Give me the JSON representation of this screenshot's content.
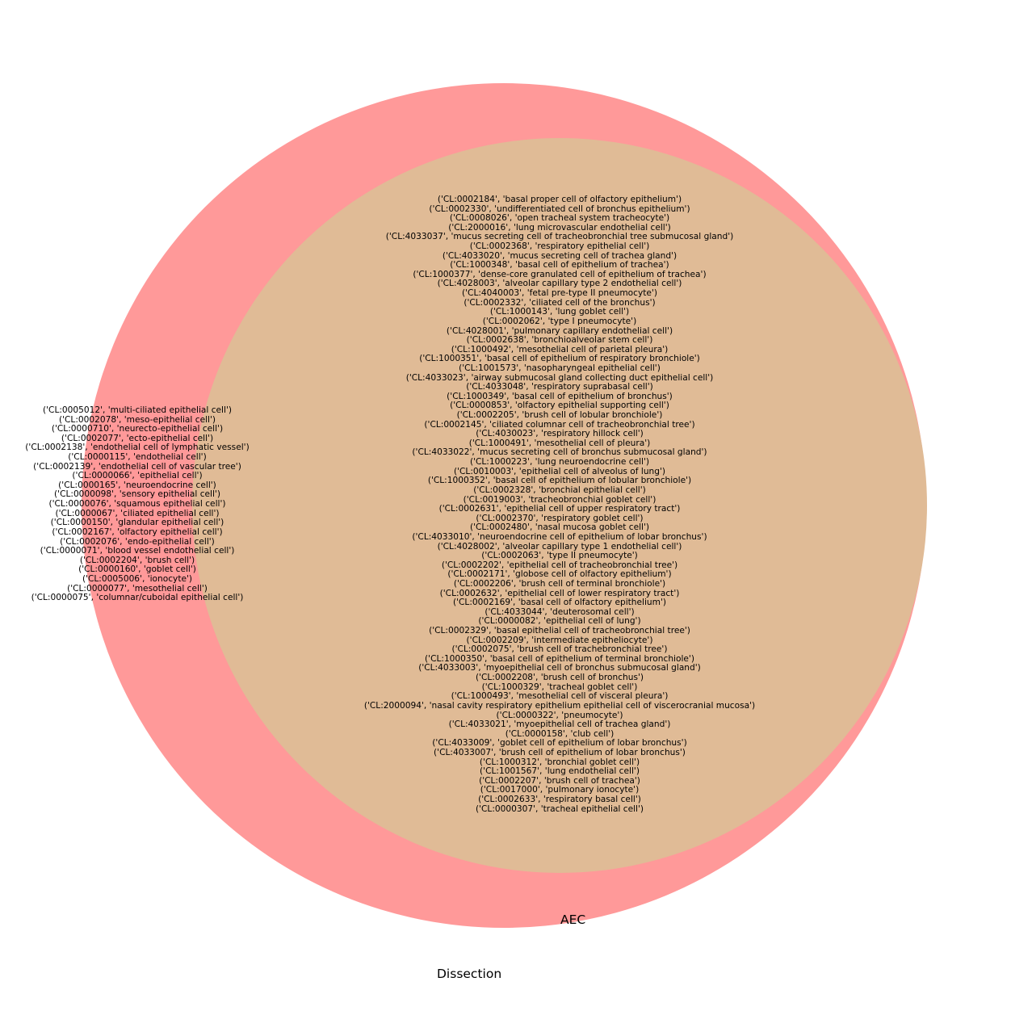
{
  "chart_data": {
    "type": "venn2",
    "title": "",
    "sets": [
      {
        "name": "Dissection",
        "size": 88,
        "color": "#ff9999"
      },
      {
        "name": "AEC",
        "size": 66,
        "color": "#e0bb96"
      }
    ],
    "relation": "AEC is a subset of Dissection",
    "regions": {
      "dissection_only": {
        "count": 21,
        "items": [
          "('CL:0005012', 'multi-ciliated epithelial cell')",
          "('CL:0002078', 'meso-epithelial cell')",
          "('CL:0000710', 'neurecto-epithelial cell')",
          "('CL:0002077', 'ecto-epithelial cell')",
          "('CL:0002138', 'endothelial cell of lymphatic vessel')",
          "('CL:0000115', 'endothelial cell')",
          "('CL:0002139', 'endothelial cell of vascular tree')",
          "('CL:0000066', 'epithelial cell')",
          "('CL:0000165', 'neuroendocrine cell')",
          "('CL:0000098', 'sensory epithelial cell')",
          "('CL:0000076', 'squamous epithelial cell')",
          "('CL:0000067', 'ciliated epithelial cell')",
          "('CL:0000150', 'glandular epithelial cell')",
          "('CL:0002167', 'olfactory epithelial cell')",
          "('CL:0002076', 'endo-epithelial cell')",
          "('CL:0000071', 'blood vessel endothelial cell')",
          "('CL:0002204', 'brush cell')",
          "('CL:0000160', 'goblet cell')",
          "('CL:0005006', 'ionocyte')",
          "('CL:0000077', 'mesothelial cell')",
          "('CL:0000075', 'columnar/cuboidal epithelial cell')"
        ]
      },
      "intersection": {
        "count": 66,
        "items": [
          "('CL:0002184', 'basal proper cell of olfactory epithelium')",
          "('CL:0002330', 'undifferentiated cell of bronchus epithelium')",
          "('CL:0008026', 'open tracheal system tracheocyte')",
          "('CL:2000016', 'lung microvascular endothelial cell')",
          "('CL:4033037', 'mucus secreting cell of tracheobronchial tree submucosal gland')",
          "('CL:0002368', 'respiratory epithelial cell')",
          "('CL:4033020', 'mucus secreting cell of trachea gland')",
          "('CL:1000348', 'basal cell of epithelium of trachea')",
          "('CL:1000377', 'dense-core granulated cell of epithelium of trachea')",
          "('CL:4028003', 'alveolar capillary type 2 endothelial cell')",
          "('CL:4040003', 'fetal pre-type II pneumocyte')",
          "('CL:0002332', 'ciliated cell of the bronchus')",
          "('CL:1000143', 'lung goblet cell')",
          "('CL:0002062', 'type I pneumocyte')",
          "('CL:4028001', 'pulmonary capillary endothelial cell')",
          "('CL:0002638', 'bronchioalveolar stem cell')",
          "('CL:1000492', 'mesothelial cell of parietal pleura')",
          "('CL:1000351', 'basal cell of epithelium of respiratory bronchiole')",
          "('CL:1001573', 'nasopharyngeal epithelial cell')",
          "('CL:4033023', 'airway submucosal gland collecting duct epithelial cell')",
          "('CL:4033048', 'respiratory suprabasal cell')",
          "('CL:1000349', 'basal cell of epithelium of bronchus')",
          "('CL:0000853', 'olfactory epithelial supporting cell')",
          "('CL:0002205', 'brush cell of lobular bronchiole')",
          "('CL:0002145', 'ciliated columnar cell of tracheobronchial tree')",
          "('CL:4030023', 'respiratory hillock cell')",
          "('CL:1000491', 'mesothelial cell of pleura')",
          "('CL:4033022', 'mucus secreting cell of bronchus submucosal gland')",
          "('CL:1000223', 'lung neuroendocrine cell')",
          "('CL:0010003', 'epithelial cell of alveolus of lung')",
          "('CL:1000352', 'basal cell of epithelium of lobular bronchiole')",
          "('CL:0002328', 'bronchial epithelial cell')",
          "('CL:0019003', 'tracheobronchial goblet cell')",
          "('CL:0002631', 'epithelial cell of upper respiratory tract')",
          "('CL:0002370', 'respiratory goblet cell')",
          "('CL:0002480', 'nasal mucosa goblet cell')",
          "('CL:4033010', 'neuroendocrine cell of epithelium of lobar bronchus')",
          "('CL:4028002', 'alveolar capillary type 1 endothelial cell')",
          "('CL:0002063', 'type II pneumocyte')",
          "('CL:0002202', 'epithelial cell of tracheobronchial tree')",
          "('CL:0002171', 'globose cell of olfactory epithelium')",
          "('CL:0002206', 'brush cell of terminal bronchiole')",
          "('CL:0002632', 'epithelial cell of lower respiratory tract')",
          "('CL:0002169', 'basal cell of olfactory epithelium')",
          "('CL:4033044', 'deuterosomal cell')",
          "('CL:0000082', 'epithelial cell of lung')",
          "('CL:0002329', 'basal epithelial cell of tracheobronchial tree')",
          "('CL:0002209', 'intermediate epitheliocyte')",
          "('CL:0002075', 'brush cell of trachebronchial tree')",
          "('CL:1000350', 'basal cell of epithelium of terminal bronchiole')",
          "('CL:4033003', 'myoepithelial cell of bronchus submucosal gland')",
          "('CL:0002208', 'brush cell of bronchus')",
          "('CL:1000329', 'tracheal goblet cell')",
          "('CL:1000493', 'mesothelial cell of visceral pleura')",
          "('CL:2000094', 'nasal cavity respiratory epithelium epithelial cell of viscerocranial mucosa')",
          "('CL:0000322', 'pneumocyte')",
          "('CL:4033021', 'myoepithelial cell of trachea gland')",
          "('CL:0000158', 'club cell')",
          "('CL:4033009', 'goblet cell of epithelium of lobar bronchus')",
          "('CL:4033007', 'brush cell of epithelium of lobar bronchus')",
          "('CL:1000312', 'bronchial goblet cell')",
          "('CL:1001567', 'lung endothelial cell')",
          "('CL:0002207', 'brush cell of trachea')",
          "('CL:0017000', 'pulmonary ionocyte')",
          "('CL:0002633', 'respiratory basal cell')",
          "('CL:0000307', 'tracheal epithelial cell')"
        ]
      }
    },
    "set_labels": {
      "aec": "AEC",
      "dissection": "Dissection"
    }
  }
}
